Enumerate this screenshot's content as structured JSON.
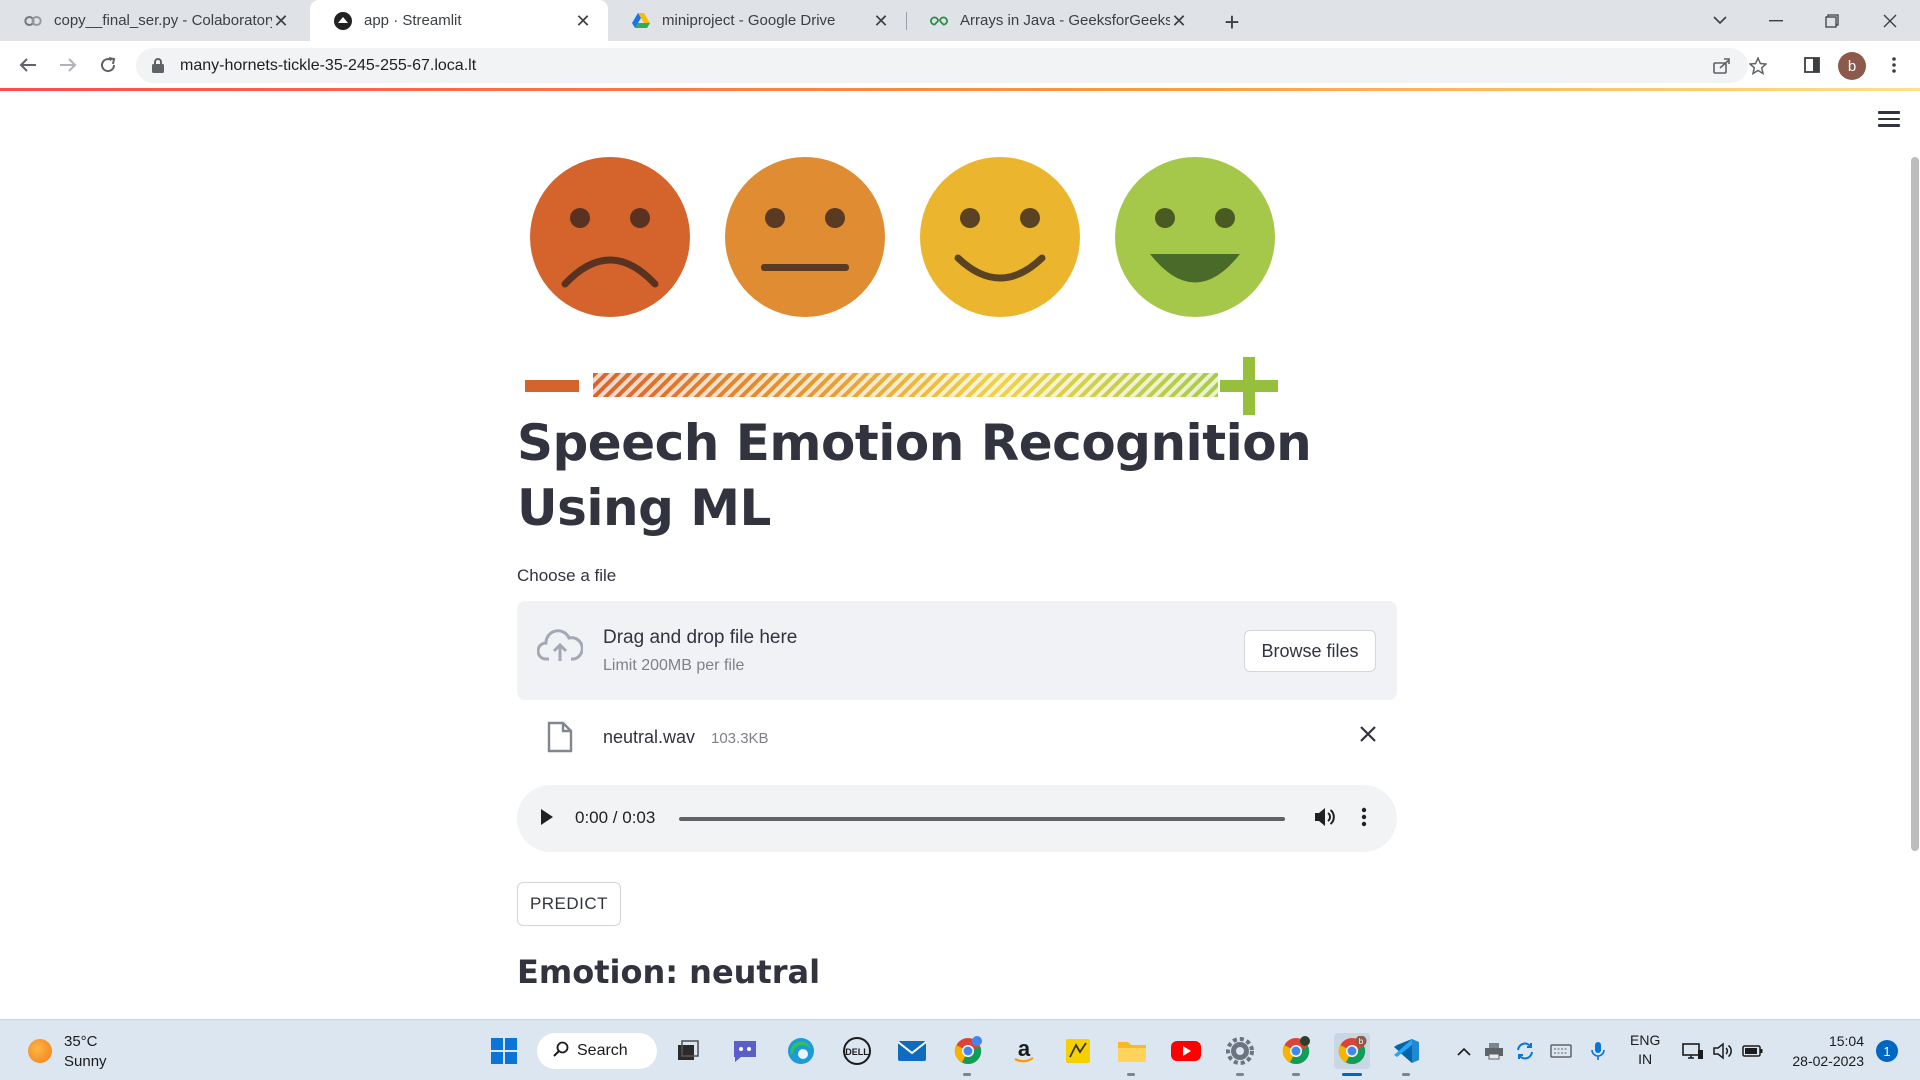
{
  "browser": {
    "tabs": [
      {
        "title": "copy__final_ser.py - Colaboratory",
        "icon": "colab-icon",
        "active": false
      },
      {
        "title": "app · Streamlit",
        "icon": "streamlit-icon",
        "active": true
      },
      {
        "title": "miniproject - Google Drive",
        "icon": "google-drive-icon",
        "active": false
      },
      {
        "title": "Arrays in Java - GeeksforGeeks",
        "icon": "geeksforgeeks-icon",
        "active": false
      }
    ],
    "url": "many-hornets-tickle-35-245-255-67.loca.lt",
    "profile_initial": "b"
  },
  "app": {
    "title": "Speech Emotion Recognition Using ML",
    "uploader": {
      "label": "Choose a file",
      "drop_text": "Drag and drop file here",
      "limit_text": "Limit 200MB per file",
      "browse_label": "Browse files"
    },
    "file": {
      "name": "neutral.wav",
      "size": "103.3KB"
    },
    "audio": {
      "time": "0:00 / 0:03",
      "progress": 0
    },
    "predict_label": "PREDICT",
    "result": "Emotion: neutral"
  },
  "taskbar": {
    "weather_temp": "35°C",
    "weather_condition": "Sunny",
    "search_label": "Search",
    "language_line1": "ENG",
    "language_line2": "IN",
    "time": "15:04",
    "date": "28-02-2023",
    "notification_count": "1",
    "chrome_badge": "b"
  },
  "colors": {
    "accent": "#ff4b4b",
    "text": "#31333f",
    "uploader_bg": "#f0f2f6",
    "taskbar_active": "#0067c0"
  }
}
